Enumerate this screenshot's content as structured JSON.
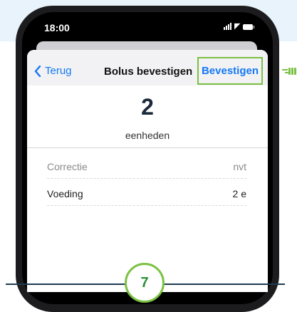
{
  "status_bar": {
    "time": "18:00",
    "icons": [
      "cellular-signal-icon",
      "wifi-icon",
      "battery-icon"
    ]
  },
  "navbar": {
    "back_label": "Terug",
    "back_icon": "chevron-left-icon",
    "title": "Bolus bevestigen",
    "confirm_label": "Bevestigen"
  },
  "bolus": {
    "amount": "2",
    "unit": "eenheden"
  },
  "details": [
    {
      "label": "Correctie",
      "value": "nvt"
    },
    {
      "label": "Voeding",
      "value": "2 e"
    }
  ],
  "annotation": {
    "step_number": "7",
    "pointer_icon": "pointing-hand-icon"
  },
  "colors": {
    "accent_blue": "#1478f5",
    "highlight_green": "#7bc143",
    "badge_text_green": "#2a8f3a",
    "navy": "#1f3b52",
    "header_bg": "#e8f3fb"
  }
}
